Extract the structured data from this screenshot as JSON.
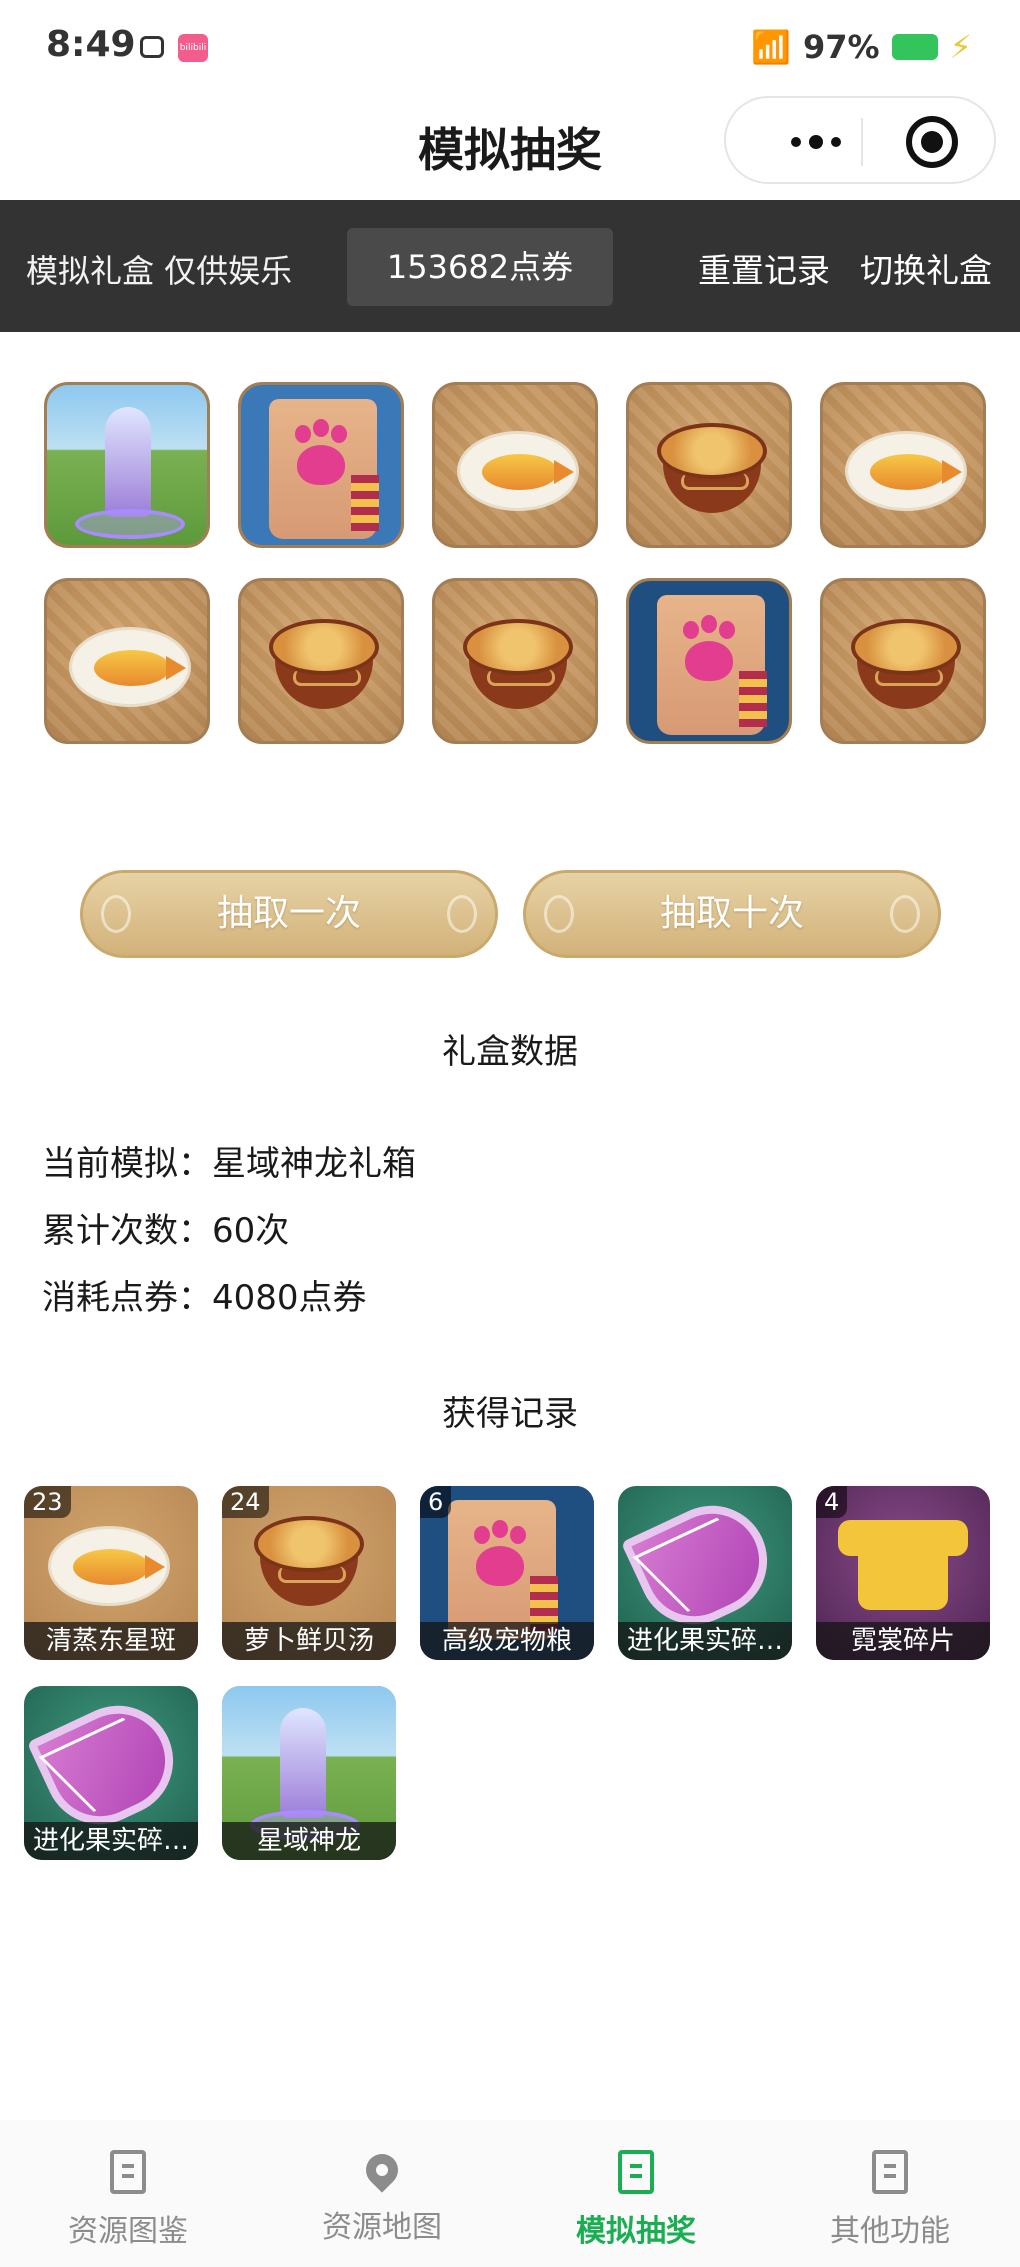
{
  "status_bar": {
    "time": "8:49",
    "app_badge": "bilibili",
    "battery": "97%"
  },
  "header": {
    "title": "模拟抽奖"
  },
  "banner": {
    "notice": "模拟礼盒 仅供娱乐",
    "coins": "153682点券",
    "reset": "重置记录",
    "switch": "切换礼盒"
  },
  "draw_grid": [
    {
      "item": "dragon"
    },
    {
      "item": "pet-food-bag"
    },
    {
      "item": "steamed-fish"
    },
    {
      "item": "soup"
    },
    {
      "item": "steamed-fish"
    },
    {
      "item": "steamed-fish"
    },
    {
      "item": "soup"
    },
    {
      "item": "soup"
    },
    {
      "item": "pet-food-bag"
    },
    {
      "item": "soup"
    }
  ],
  "buttons": {
    "draw_once": "抽取一次",
    "draw_ten": "抽取十次"
  },
  "stats": {
    "title": "礼盒数据",
    "current_label": "当前模拟：",
    "current_value": "星域神龙礼箱",
    "count_label": "累计次数：",
    "count_value": "60次",
    "cost_label": "消耗点券：",
    "cost_value": "4080点券"
  },
  "records": {
    "title": "获得记录",
    "items": [
      {
        "count": "23",
        "name": "清蒸东星斑"
      },
      {
        "count": "24",
        "name": "萝卜鲜贝汤"
      },
      {
        "count": "6",
        "name": "高级宠物粮"
      },
      {
        "count": "",
        "name": "进化果实碎…"
      },
      {
        "count": "4",
        "name": "霓裳碎片"
      },
      {
        "count": "",
        "name": "进化果实碎…"
      },
      {
        "count": "",
        "name": "星域神龙"
      }
    ]
  },
  "tabbar": {
    "tab1": "资源图鉴",
    "tab2": "资源地图",
    "tab3": "模拟抽奖",
    "tab4": "其他功能"
  },
  "colors": {
    "accent": "#1aad52",
    "banner_bg": "#333333",
    "button": "#d9bc88"
  }
}
